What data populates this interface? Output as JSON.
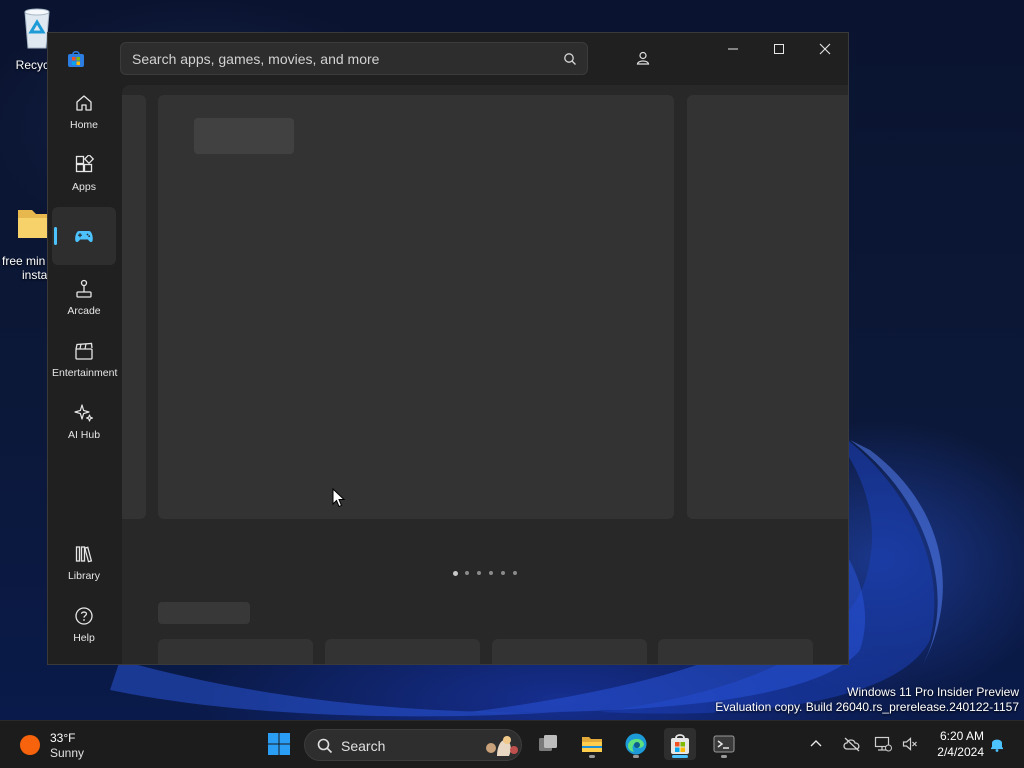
{
  "desktop": {
    "icons": [
      {
        "label": "Recycle"
      },
      {
        "label_line1": "free min",
        "label_line2": "insta"
      }
    ],
    "watermark": {
      "line1": "Windows 11 Pro Insider Preview",
      "line2": "Evaluation copy. Build 26040.rs_prerelease.240122-1157"
    }
  },
  "store": {
    "search": {
      "placeholder": "Search apps, games, movies, and more"
    },
    "nav": {
      "home": "Home",
      "apps": "Apps",
      "gaming": "",
      "arcade": "Arcade",
      "entertainment": "Entertainment",
      "ai_hub": "AI Hub",
      "library": "Library",
      "help": "Help"
    },
    "active_nav": "gaming",
    "carousel": {
      "page_count": 6,
      "active_page": 1
    },
    "accent": "#4cc2ff"
  },
  "taskbar": {
    "weather": {
      "temp": "33°F",
      "condition": "Sunny"
    },
    "search_label": "Search",
    "clock": {
      "time": "6:20 AM",
      "date": "2/4/2024"
    }
  }
}
